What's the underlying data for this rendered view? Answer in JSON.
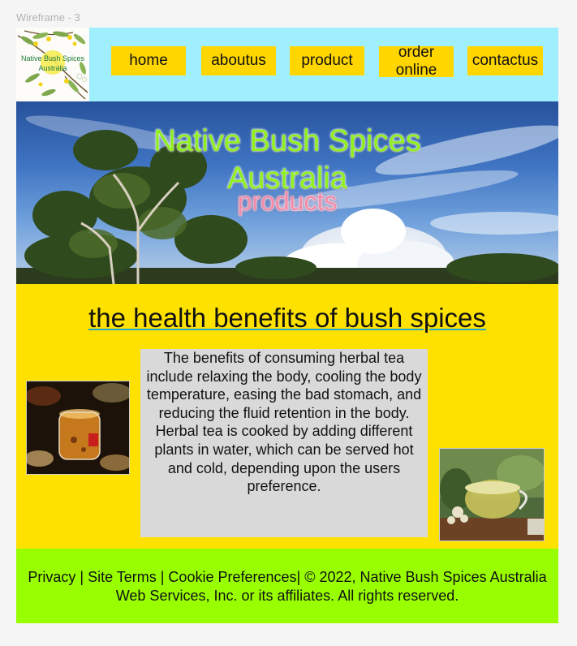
{
  "frame": {
    "label": "Wireframe - 3"
  },
  "header": {
    "logo": {
      "line1": "Native Bush Spices",
      "line2": "Australia"
    },
    "nav": [
      {
        "label": "home"
      },
      {
        "label": "aboutus"
      },
      {
        "label": "product"
      },
      {
        "label": "order online"
      },
      {
        "label": "contactus"
      }
    ]
  },
  "hero": {
    "title_line1": "Native Bush Spices",
    "title_line2": "Australia",
    "subtitle": "products"
  },
  "main": {
    "heading": "the health benefits of bush spices",
    "body": "The benefits of consuming herbal tea include relaxing the body, cooling the body temperature, easing the bad stomach, and reducing the fluid retention in the body. Herbal tea is cooked by adding different plants in water, which can be served hot and cold, depending upon the users preference."
  },
  "footer": {
    "text": "Privacy | Site Terms | Cookie Preferences| ©  2022, Native Bush Spices Australia Web Services, Inc. or its affiliates. All rights reserved."
  },
  "colors": {
    "header_bg": "#9fefff",
    "nav_button": "#ffd600",
    "main_bg": "#ffe100",
    "text_box_bg": "#d9d9d9",
    "footer_bg": "#99ff00",
    "hero_title": "#8ef01c",
    "hero_subtitle": "#f48aa8"
  },
  "images": {
    "logo": "wattle-branch-illustration",
    "hero": "eucalyptus-trees-blue-sky-clouds",
    "photo_left": "herbal-tea-cup-with-spices",
    "photo_right": "herbal-tea-cup-with-plants"
  }
}
